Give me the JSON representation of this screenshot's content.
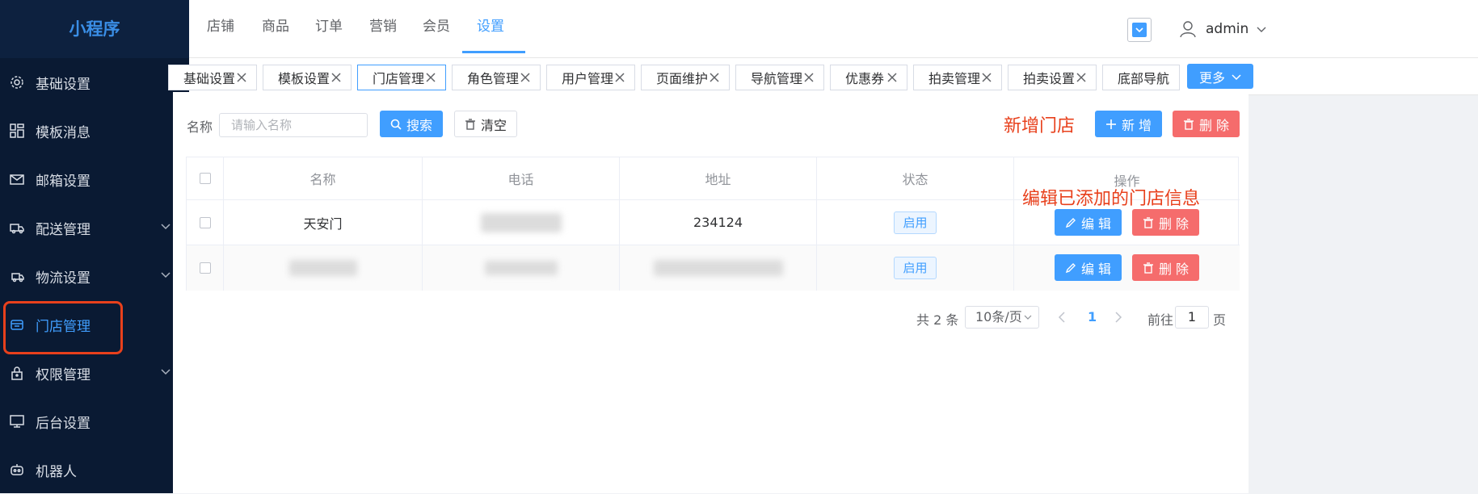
{
  "sidebar": {
    "title": "小程序",
    "items": [
      {
        "label": "基础设置",
        "icon": "gear-icon"
      },
      {
        "label": "模板消息",
        "icon": "grid-icon"
      },
      {
        "label": "邮箱设置",
        "icon": "mail-icon"
      },
      {
        "label": "配送管理",
        "icon": "truck-icon"
      },
      {
        "label": "物流设置",
        "icon": "delivery-icon"
      },
      {
        "label": "门店管理",
        "icon": "store-icon"
      },
      {
        "label": "权限管理",
        "icon": "lock-icon"
      },
      {
        "label": "后台设置",
        "icon": "monitor-icon"
      },
      {
        "label": "机器人",
        "icon": "robot-icon"
      }
    ]
  },
  "topnav": {
    "tabs": [
      "店铺",
      "商品",
      "订单",
      "营销",
      "会员",
      "设置"
    ],
    "active": "设置",
    "user": "admin"
  },
  "tagbar": {
    "tags": [
      "基础设置",
      "模板设置",
      "门店管理",
      "角色管理",
      "用户管理",
      "页面维护",
      "导航管理",
      "优惠券",
      "拍卖管理",
      "拍卖设置",
      "底部导航"
    ],
    "active": "门店管理",
    "more_label": "更多"
  },
  "filter": {
    "name_label": "名称",
    "name_placeholder": "请输入名称",
    "search_label": "搜索",
    "clear_label": "清空",
    "add_label": "新 增",
    "delete_label": "删 除"
  },
  "annotations": {
    "add_store": "新增门店",
    "edit_store": "编辑已添加的门店信息"
  },
  "table": {
    "headers": [
      "名称",
      "电话",
      "地址",
      "状态",
      "操作"
    ],
    "rows": [
      {
        "name": "天安门",
        "address": "234124",
        "status": "启用"
      },
      {
        "status": "启用"
      }
    ],
    "edit_label": "编 辑",
    "delete_label": "删 除"
  },
  "pagination": {
    "total": "共 2 条",
    "page_size": "10条/页",
    "current_page": "1",
    "goto_label": "前往",
    "goto_value": "1",
    "page_word": "页"
  },
  "colors": {
    "sidebar_bg": "#0a1a33",
    "primary": "#409eff",
    "danger": "#f56c6c",
    "annotation": "#e8401c"
  }
}
